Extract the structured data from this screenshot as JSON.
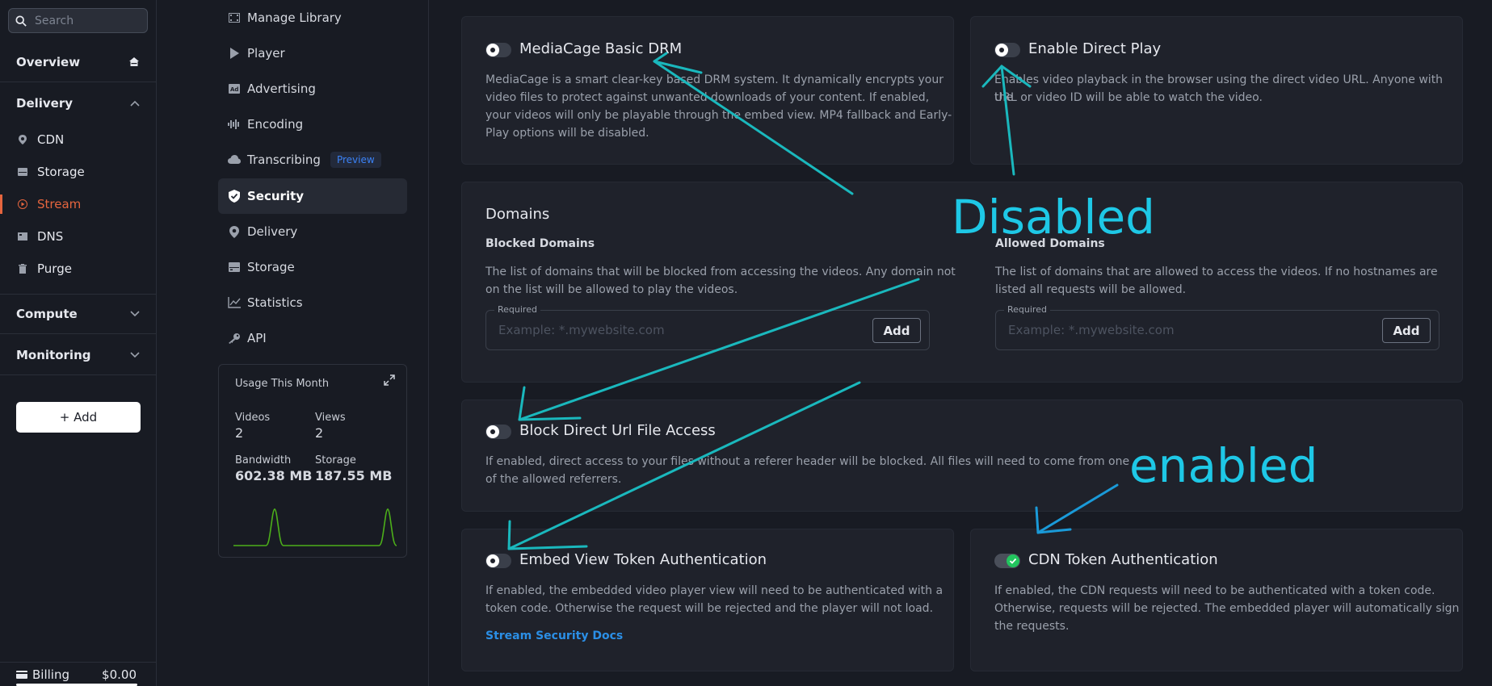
{
  "sidebar": {
    "search_placeholder": "Search",
    "groups": [
      {
        "label": "Overview"
      },
      {
        "label": "Delivery"
      },
      {
        "label": "Compute"
      },
      {
        "label": "Monitoring"
      }
    ],
    "delivery_items": [
      {
        "label": "CDN",
        "icon": "pin-icon"
      },
      {
        "label": "Storage",
        "icon": "storage-icon"
      },
      {
        "label": "Stream",
        "icon": "play-icon",
        "active": true
      },
      {
        "label": "DNS",
        "icon": "dns-icon"
      },
      {
        "label": "Purge",
        "icon": "trash-icon"
      }
    ],
    "add_label": "+ Add",
    "billing_label": "Billing",
    "billing_value": "$0.00"
  },
  "subnav": {
    "items": [
      {
        "label": "Manage Library"
      },
      {
        "label": "Player"
      },
      {
        "label": "Advertising"
      },
      {
        "label": "Encoding"
      },
      {
        "label": "Transcribing",
        "badge": "Preview"
      },
      {
        "label": "Security",
        "active": true
      },
      {
        "label": "Delivery"
      },
      {
        "label": "Storage"
      },
      {
        "label": "Statistics"
      },
      {
        "label": "API"
      }
    ],
    "usage": {
      "title": "Usage This Month",
      "videos_label": "Videos",
      "videos_value": "2",
      "views_label": "Views",
      "views_value": "2",
      "bandwidth_label": "Bandwidth",
      "bandwidth_value": "602.38 MB",
      "storage_label": "Storage",
      "storage_value": "187.55 MB",
      "sparkline_color": "#4caf1a"
    }
  },
  "security": {
    "drm": {
      "title": "MediaCage Basic DRM",
      "enabled": false,
      "desc_1": "MediaCage is a smart clear-key based DRM system. It dynamically encrypts your",
      "desc_2": "video files to protect against unwanted downloads of your content. If enabled,",
      "desc_3": "your videos will only be playable through the embed view. MP4 fallback and Early-",
      "desc_4": "Play options will be disabled."
    },
    "direct_play": {
      "title": "Enable Direct Play",
      "enabled": false,
      "desc_1": "Enables video playback in the browser using the direct video URL. Anyone with the",
      "desc_2": "URL or video ID will be able to watch the video."
    },
    "domains": {
      "title": "Domains",
      "blocked_title": "Blocked Domains",
      "blocked_desc_1": "The list of domains that will be blocked from accessing the videos. Any domain not",
      "blocked_desc_2": "on the list will be allowed to play the videos.",
      "allowed_title": "Allowed Domains",
      "allowed_desc_1": "The list of domains that are allowed to access the videos. If no hostnames are",
      "allowed_desc_2": "listed all requests will be allowed.",
      "required_label": "Required",
      "placeholder": "Example: *.mywebsite.com",
      "add_label": "Add"
    },
    "block_direct": {
      "title": "Block Direct Url File Access",
      "enabled": false,
      "desc_1": "If enabled, direct access to your files without a referer header will be blocked. All files will need to come from one",
      "desc_2": "of the allowed referrers."
    },
    "embed_token": {
      "title": "Embed View Token Authentication",
      "enabled": false,
      "desc_1": "If enabled, the embedded video player view will need to be authenticated with a",
      "desc_2": "token code. Otherwise the request will be rejected and the player will not load.",
      "link": "Stream Security Docs"
    },
    "cdn_token": {
      "title": "CDN Token Authentication",
      "enabled": true,
      "desc_1": "If enabled, the CDN requests will need to be authenticated with a token code.",
      "desc_2": "Otherwise, requests will be rejected. The embedded player will automatically sign",
      "desc_3": "the requests."
    }
  },
  "annotations": {
    "disabled_label": "Disabled",
    "enabled_label": "enabled",
    "arrow_color": "#1ab8bd",
    "enabled_arrow_color": "#1a9ad8",
    "text_color": "#1ec8e6"
  },
  "colors": {
    "accent": "#e5653e",
    "link": "#2b8fe6",
    "toggle_on": "#22c55e",
    "background": "#181b23",
    "card": "#1f222b"
  }
}
